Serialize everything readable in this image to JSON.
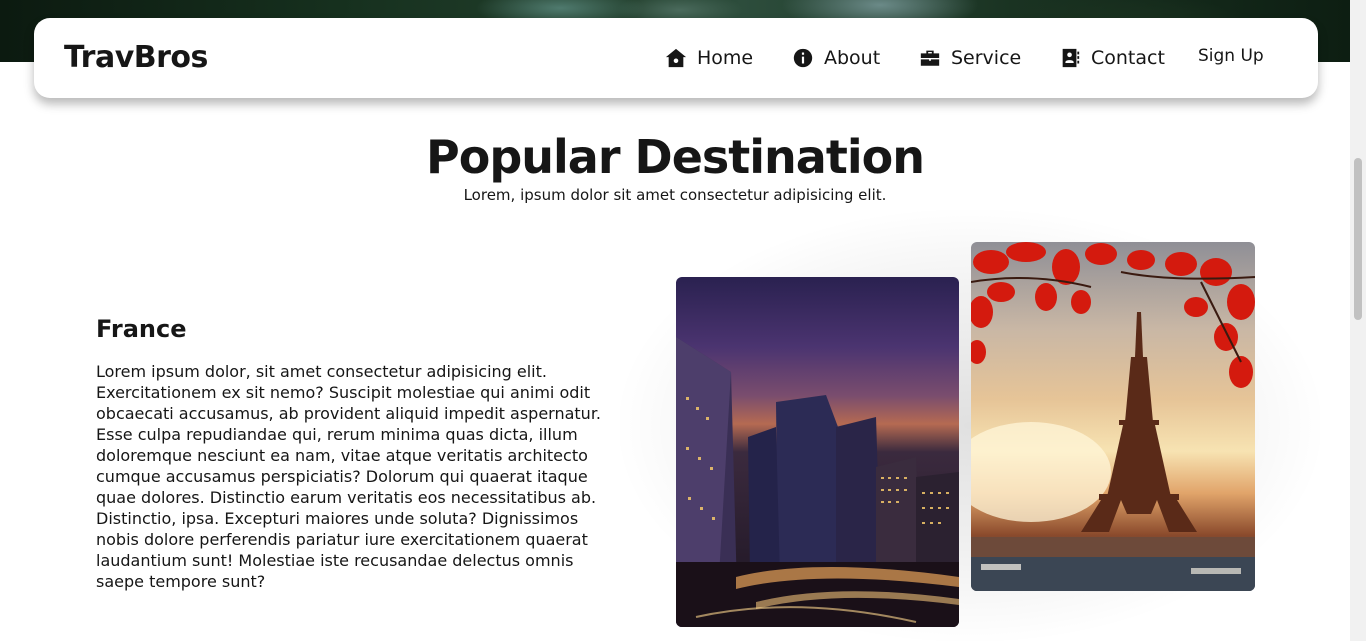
{
  "navbar": {
    "brand": "TravBros",
    "items": [
      {
        "label": "Home",
        "icon": "home-icon"
      },
      {
        "label": "About",
        "icon": "info-icon"
      },
      {
        "label": "Service",
        "icon": "briefcase-icon"
      },
      {
        "label": "Contact",
        "icon": "contact-book-icon"
      }
    ],
    "signup_label": "Sign Up"
  },
  "section": {
    "title": "Popular Destination",
    "subtitle": "Lorem, ipsum dolor sit amet consectetur adipisicing elit."
  },
  "destination": {
    "name": "France",
    "description": "Lorem ipsum dolor, sit amet consectetur adipisicing elit. Exercitationem ex sit nemo? Suscipit molestiae qui animi odit obcaecati accusamus, ab provident aliquid impedit aspernatur. Esse culpa repudiandae qui, rerum minima quas dicta, illum doloremque nesciunt ea nam, vitae atque veritatis architecto cumque accusamus perspiciatis? Dolorum qui quaerat itaque quae dolores. Distinctio earum veritatis eos necessitatibus ab. Distinctio, ipsa. Excepturi maiores unde soluta? Dignissimos nobis dolore perferendis pariatur iure exercitationem quaerat laudantium sunt! Molestiae iste recusandae delectus omnis saepe tempore sunt?",
    "images": [
      "city-skyline-photo",
      "eiffel-tower-photo"
    ]
  },
  "colors": {
    "text": "#161616",
    "background": "#ffffff"
  }
}
